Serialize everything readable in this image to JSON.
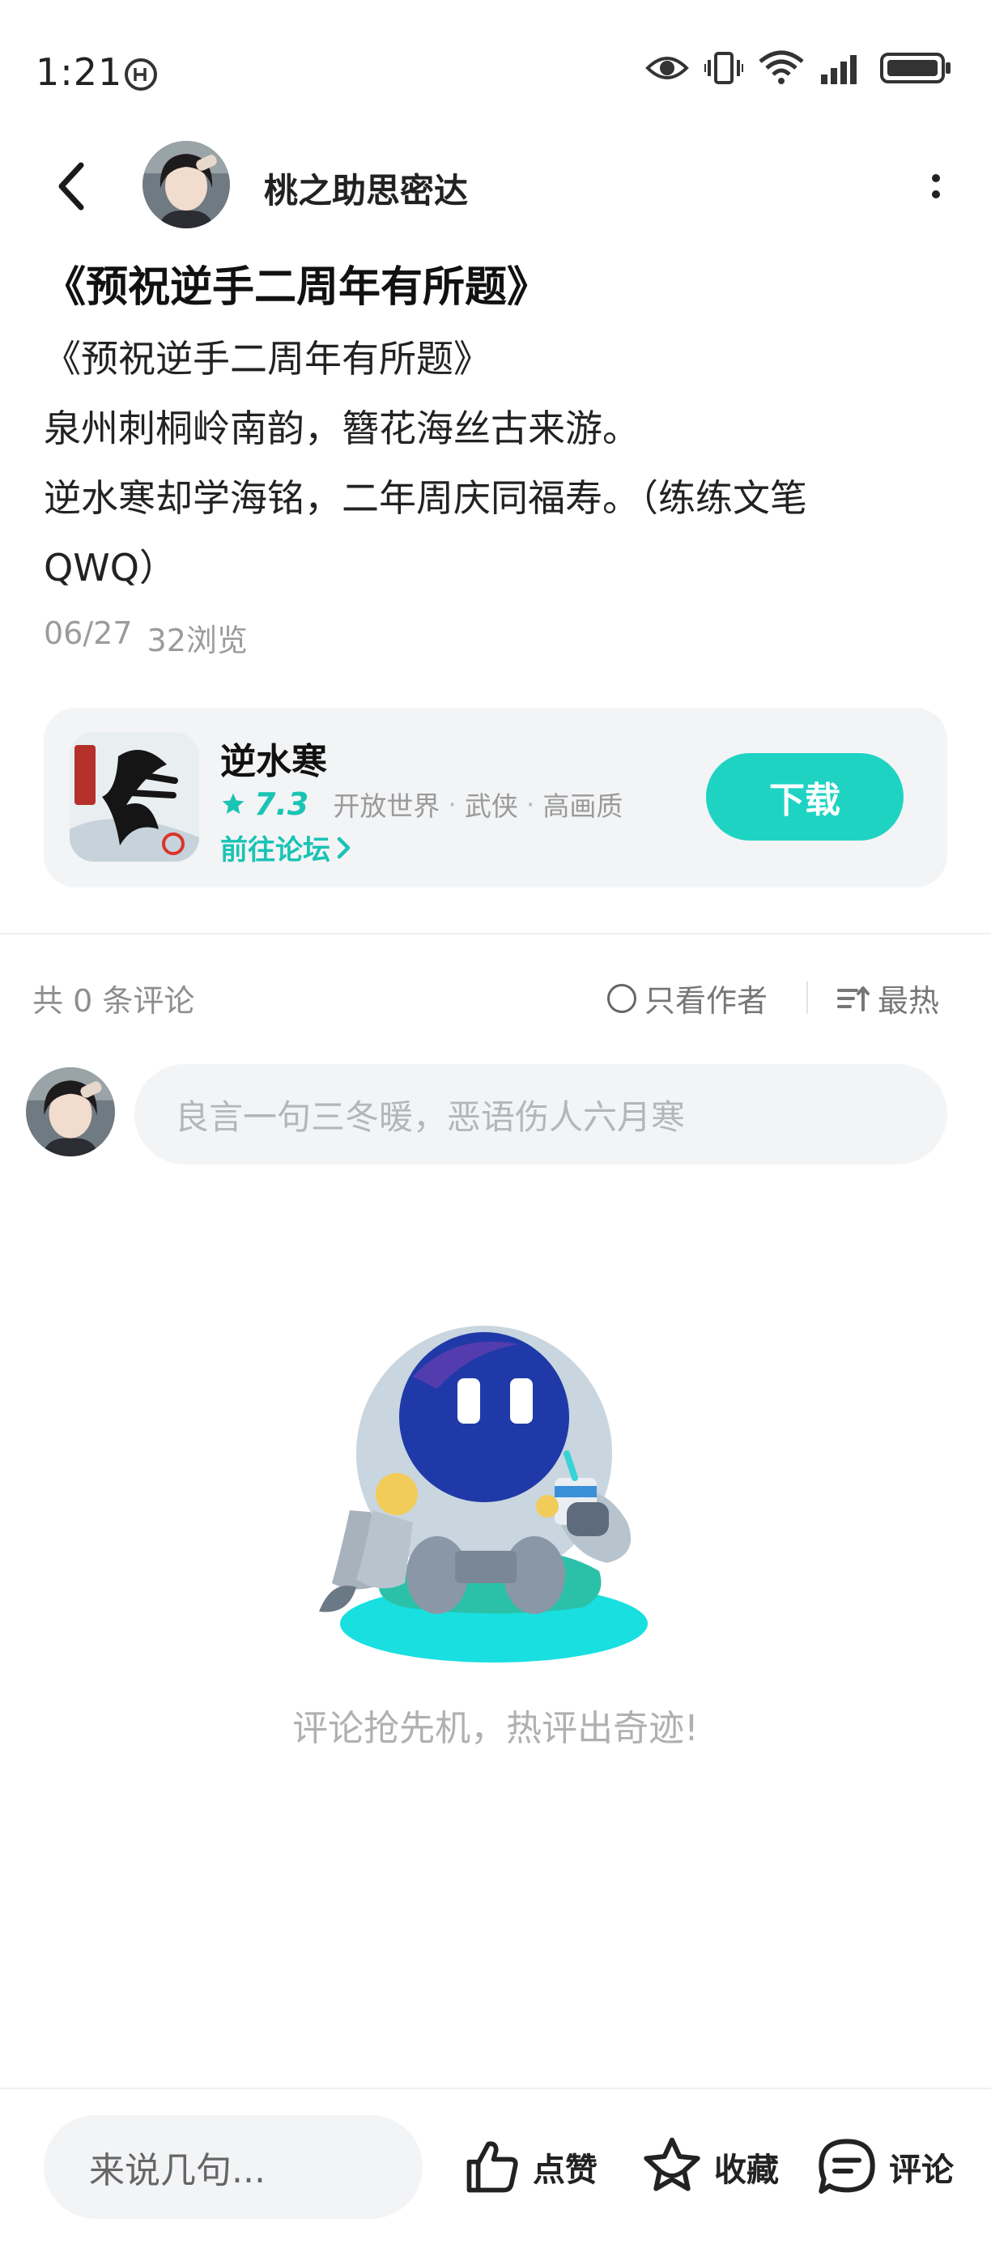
{
  "status_bar": {
    "time": "1:21",
    "icons": [
      "eye-icon",
      "vibrate-icon",
      "wifi-icon",
      "signal-icon",
      "battery-icon"
    ]
  },
  "header": {
    "author_name": "桃之助思密达",
    "back_icon": "chevron-left-icon",
    "more_icon": "more-vertical-icon"
  },
  "post": {
    "title": "《预祝逆手二周年有所题》",
    "body_lines": [
      "《预祝逆手二周年有所题》",
      "泉州刺桐岭南韵，簪花海丝古来游。",
      "逆水寒却学海铭，二年周庆同福寿。（练练文笔",
      "QWQ）"
    ],
    "date": "06/27",
    "views": "32浏览"
  },
  "game_card": {
    "name": "逆水寒",
    "score": "7.3",
    "tags": [
      "开放世界",
      "武侠",
      "高画质"
    ],
    "forum_link": "前往论坛",
    "download_label": "下载",
    "accent": "#1fd3c3"
  },
  "comments": {
    "count_label": "共 0 条评论",
    "author_only_label": "只看作者",
    "sort_label": "最热",
    "input_placeholder": "良言一句三冬暖，恶语伤人六月寒",
    "empty_text": "评论抢先机，热评出奇迹!"
  },
  "bottom_bar": {
    "input_placeholder": "来说几句...",
    "like_label": "点赞",
    "fav_label": "收藏",
    "comment_label": "评论"
  }
}
